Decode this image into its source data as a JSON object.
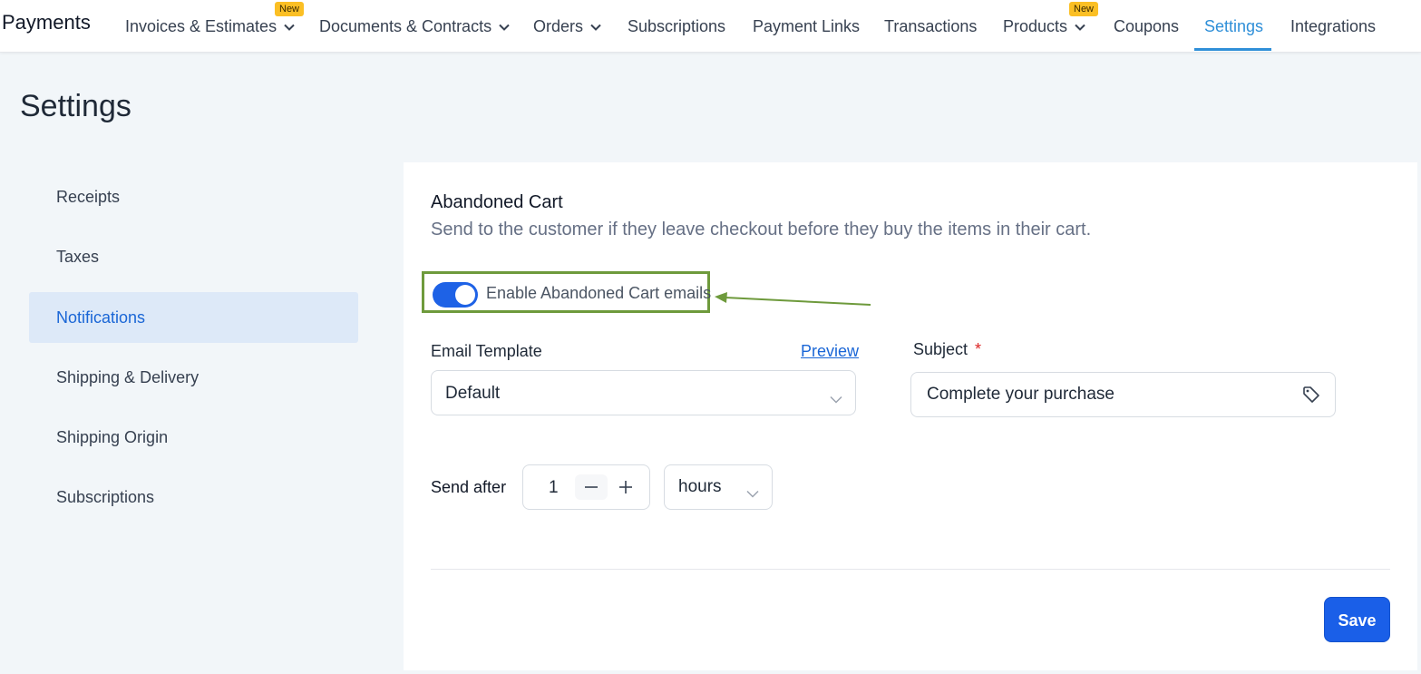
{
  "app": {
    "title": "Payments"
  },
  "nav": {
    "items": [
      {
        "label": "Invoices & Estimates",
        "badge": "New",
        "has_dropdown": true
      },
      {
        "label": "Documents & Contracts",
        "has_dropdown": true
      },
      {
        "label": "Orders",
        "has_dropdown": true
      },
      {
        "label": "Subscriptions"
      },
      {
        "label": "Payment Links"
      },
      {
        "label": "Transactions"
      },
      {
        "label": "Products",
        "badge": "New",
        "has_dropdown": true
      },
      {
        "label": "Coupons"
      },
      {
        "label": "Settings",
        "active": true
      },
      {
        "label": "Integrations"
      }
    ]
  },
  "page": {
    "title": "Settings"
  },
  "sidebar": {
    "items": [
      {
        "label": "Receipts"
      },
      {
        "label": "Taxes"
      },
      {
        "label": "Notifications",
        "active": true
      },
      {
        "label": "Shipping & Delivery"
      },
      {
        "label": "Shipping Origin"
      },
      {
        "label": "Subscriptions"
      }
    ]
  },
  "abandoned_cart": {
    "title": "Abandoned Cart",
    "description": "Send to the customer if they leave checkout before they buy the items in their cart.",
    "toggle": {
      "label": "Enable Abandoned Cart emails",
      "enabled": true
    },
    "email_template": {
      "label": "Email Template",
      "preview_label": "Preview",
      "value": "Default"
    },
    "subject": {
      "label": "Subject",
      "required_mark": "*",
      "value": "Complete your purchase"
    },
    "send_after": {
      "label": "Send after",
      "value": "1",
      "unit": "hours"
    },
    "save_label": "Save"
  },
  "colors": {
    "accent": "#1a5fe8",
    "nav_active": "#2f8fd8",
    "badge": "#fbbf24",
    "highlight_box": "#6e9a3c",
    "sidebar_active_bg": "#dde9f8"
  }
}
